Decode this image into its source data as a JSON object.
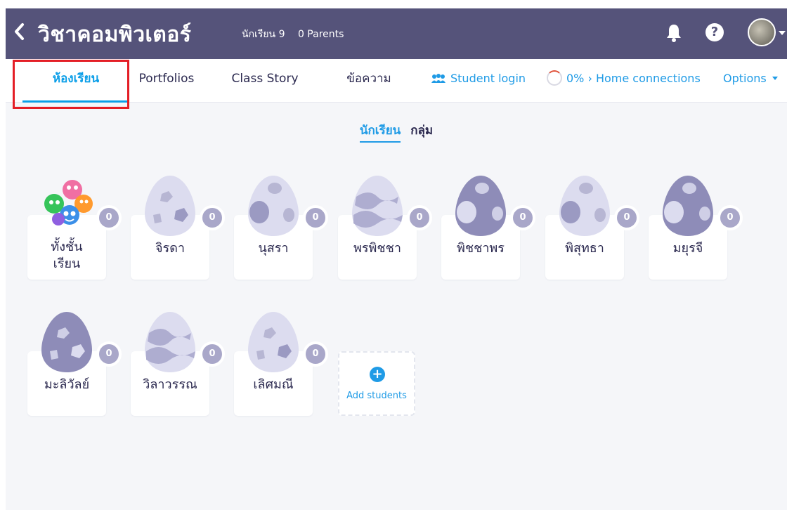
{
  "header": {
    "class_title": "วิชาคอมพิวเตอร์",
    "students_count": "นักเรียน 9",
    "parents_count": "0 Parents",
    "back_icon": "chevron-left-icon",
    "notification_icon": "bell-icon",
    "help_icon": "help-icon",
    "help_glyph": "?"
  },
  "nav": {
    "tabs": [
      {
        "label": "ห้องเรียน",
        "active": true
      },
      {
        "label": "Portfolios",
        "active": false
      },
      {
        "label": "Class Story",
        "active": false
      },
      {
        "label": "ข้อความ",
        "active": false
      }
    ],
    "student_login": "Student login",
    "home_connections": "0% › Home connections",
    "options": "Options"
  },
  "view_toggle": {
    "students": "นักเรียน",
    "groups": "กลุ่ม",
    "active": "students"
  },
  "students": [
    {
      "name": "ทั้งชั้นเรียน",
      "name_line1": "ทั้งชั้น",
      "name_line2": "เรียน",
      "points": "0",
      "avatar": "monsters-class-icon"
    },
    {
      "name": "จิรดา",
      "points": "0",
      "avatar": "egg-rocks-light"
    },
    {
      "name": "นุสรา",
      "points": "0",
      "avatar": "egg-spots-light"
    },
    {
      "name": "พรพิชชา",
      "points": "0",
      "avatar": "egg-waves-light"
    },
    {
      "name": "พิชชาพร",
      "points": "0",
      "avatar": "egg-spots-dark"
    },
    {
      "name": "พิสุทธา",
      "points": "0",
      "avatar": "egg-spots-light"
    },
    {
      "name": "มยุรจี",
      "points": "0",
      "avatar": "egg-spots-dark"
    },
    {
      "name": "มะลิวัลย์",
      "points": "0",
      "avatar": "egg-rocks-dark"
    },
    {
      "name": "วิลาวรรณ",
      "points": "0",
      "avatar": "egg-waves-light"
    },
    {
      "name": "เลิศมณี",
      "points": "0",
      "avatar": "egg-rocks-light"
    }
  ],
  "add_students": {
    "label": "Add students",
    "glyph": "+"
  },
  "colors": {
    "header_bg": "#55537a",
    "accent": "#1f9be6",
    "highlight_box": "#e41e26",
    "badge": "#a9a7c9"
  }
}
